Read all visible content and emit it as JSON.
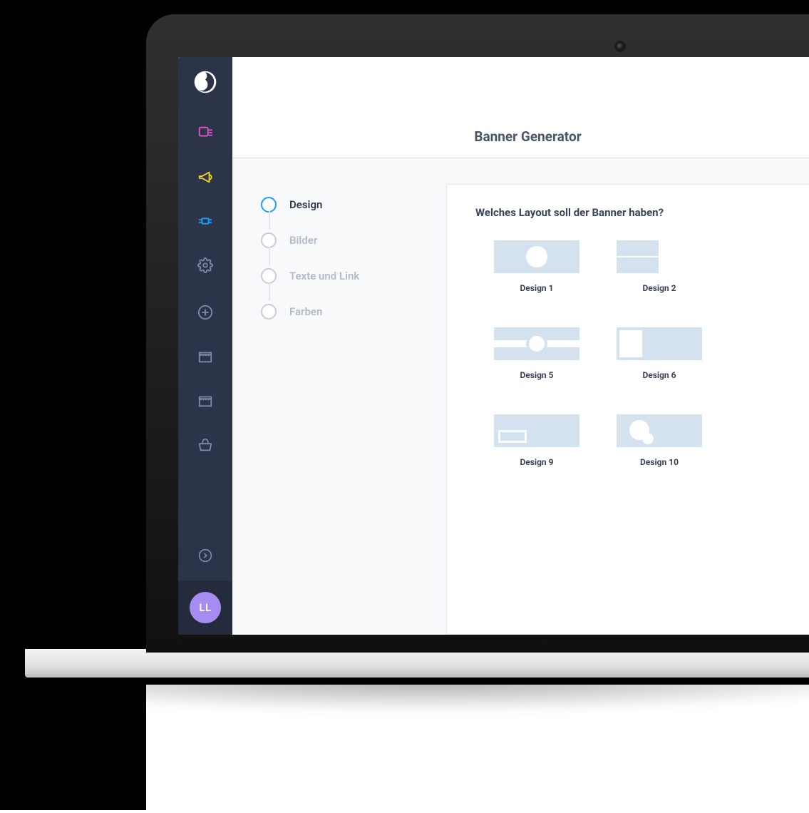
{
  "app": {
    "title": "Banner Generator",
    "sidebar": {
      "avatar_initials": "LL"
    },
    "stepper": {
      "steps": [
        {
          "label": "Design",
          "active": true
        },
        {
          "label": "Bilder",
          "active": false
        },
        {
          "label": "Texte und Link",
          "active": false
        },
        {
          "label": "Farben",
          "active": false
        }
      ]
    },
    "panel": {
      "question": "Welches Layout soll der Banner haben?",
      "designs": [
        {
          "label": "Design 1"
        },
        {
          "label": "Design 2"
        },
        {
          "label": "Design 5"
        },
        {
          "label": "Design 6"
        },
        {
          "label": "Design 9"
        },
        {
          "label": "Design 10"
        }
      ]
    }
  }
}
